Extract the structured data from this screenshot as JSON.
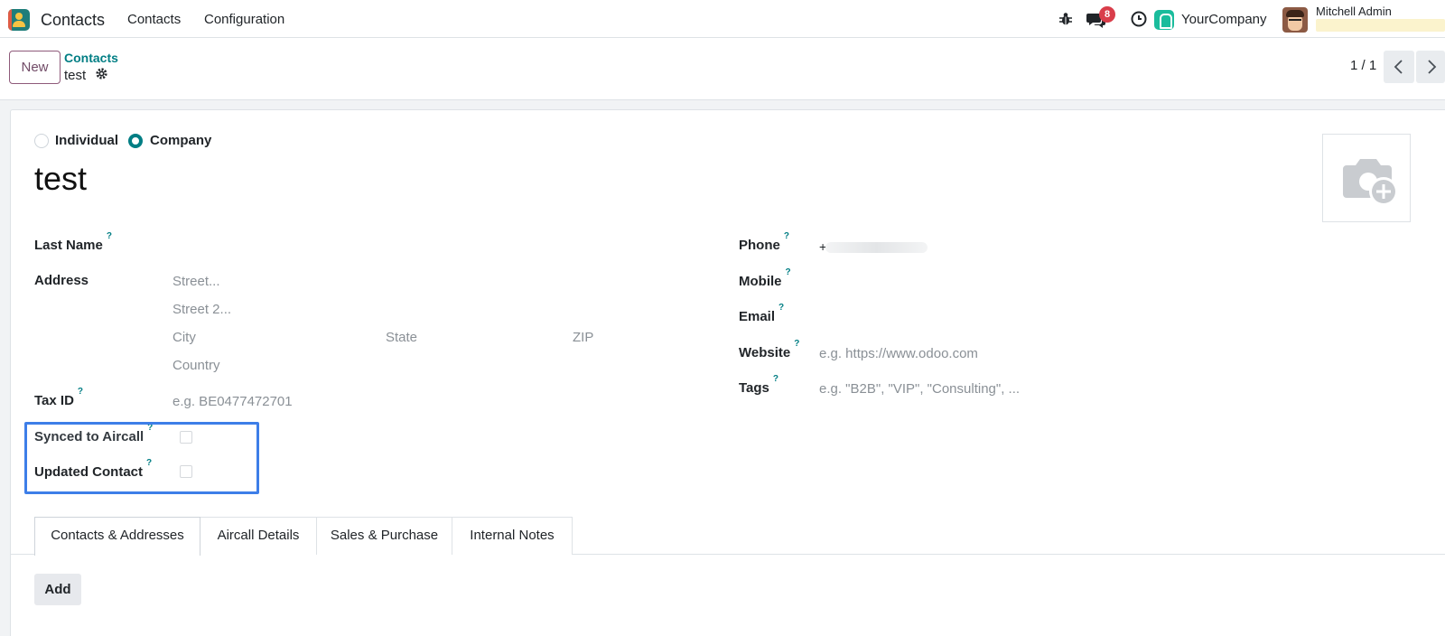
{
  "app": {
    "name": "Contacts",
    "menu": [
      "Contacts",
      "Configuration"
    ]
  },
  "systray": {
    "messages_count": "8",
    "company": "YourCompany",
    "user_name": "Mitchell Admin"
  },
  "control_panel": {
    "new_label": "New",
    "breadcrumb_parent": "Contacts",
    "breadcrumb_current": "test",
    "pager": "1 / 1"
  },
  "form": {
    "company_type_options": {
      "individual": "Individual",
      "company": "Company",
      "selected": "company"
    },
    "name": "test",
    "left_fields": {
      "last_name_label": "Last Name",
      "address_label": "Address",
      "street_placeholder": "Street...",
      "street2_placeholder": "Street 2...",
      "city_placeholder": "City",
      "state_placeholder": "State",
      "zip_placeholder": "ZIP",
      "country_placeholder": "Country",
      "tax_id_label": "Tax ID",
      "tax_id_placeholder": "e.g. BE0477472701",
      "synced_label": "Synced to Aircall",
      "updated_label": "Updated Contact"
    },
    "right_fields": {
      "phone_label": "Phone",
      "phone_value": "+",
      "mobile_label": "Mobile",
      "email_label": "Email",
      "website_label": "Website",
      "website_placeholder": "e.g. https://www.odoo.com",
      "tags_label": "Tags",
      "tags_placeholder": "e.g. \"B2B\", \"VIP\", \"Consulting\", ..."
    },
    "help_mark": "?"
  },
  "tabs": [
    {
      "label": "Contacts & Addresses",
      "active": true
    },
    {
      "label": "Aircall Details",
      "active": false
    },
    {
      "label": "Sales & Purchase",
      "active": false
    },
    {
      "label": "Internal Notes",
      "active": false
    }
  ],
  "tab_content": {
    "add_label": "Add"
  },
  "colors": {
    "primary": "#714b67",
    "accent": "#017e84",
    "highlight": "#3d7ee8",
    "badge": "#d93d4a"
  },
  "icons": [
    "bug-icon",
    "chat-icon",
    "clock-icon",
    "gear-icon",
    "chevron-left-icon",
    "chevron-right-icon",
    "camera-plus-icon"
  ]
}
